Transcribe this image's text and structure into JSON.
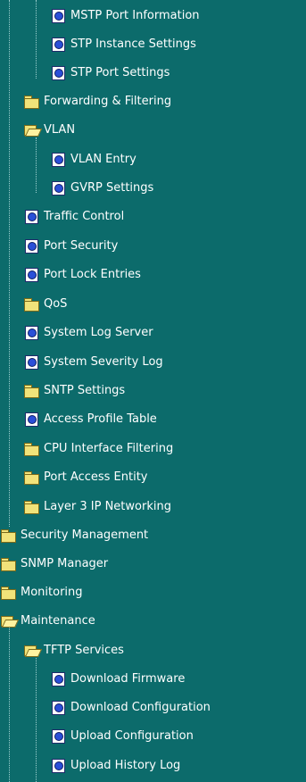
{
  "tree": {
    "items": [
      {
        "label": "MSTP Port Information",
        "icon": "doc-icon"
      },
      {
        "label": "STP Instance Settings",
        "icon": "doc-icon"
      },
      {
        "label": "STP Port Settings",
        "icon": "doc-icon"
      },
      {
        "label": "Forwarding & Filtering",
        "icon": "folder-closed-icon"
      },
      {
        "label": "VLAN",
        "icon": "folder-open-icon"
      },
      {
        "label": "VLAN Entry",
        "icon": "doc-icon"
      },
      {
        "label": "GVRP Settings",
        "icon": "doc-icon"
      },
      {
        "label": "Traffic Control",
        "icon": "doc-icon"
      },
      {
        "label": "Port Security",
        "icon": "doc-icon"
      },
      {
        "label": "Port Lock Entries",
        "icon": "doc-icon"
      },
      {
        "label": "QoS",
        "icon": "folder-closed-icon"
      },
      {
        "label": "System Log Server",
        "icon": "doc-icon"
      },
      {
        "label": "System Severity Log",
        "icon": "doc-icon"
      },
      {
        "label": "SNTP Settings",
        "icon": "folder-closed-icon"
      },
      {
        "label": "Access Profile Table",
        "icon": "doc-icon"
      },
      {
        "label": "CPU Interface Filtering",
        "icon": "folder-closed-icon"
      },
      {
        "label": "Port Access Entity",
        "icon": "folder-closed-icon"
      },
      {
        "label": "Layer 3 IP Networking",
        "icon": "folder-closed-icon"
      },
      {
        "label": "Security Management",
        "icon": "folder-closed-icon"
      },
      {
        "label": "SNMP Manager",
        "icon": "folder-closed-icon"
      },
      {
        "label": "Monitoring",
        "icon": "folder-closed-icon"
      },
      {
        "label": "Maintenance",
        "icon": "folder-open-icon"
      },
      {
        "label": "TFTP Services",
        "icon": "folder-open-icon"
      },
      {
        "label": "Download Firmware",
        "icon": "doc-icon"
      },
      {
        "label": "Download Configuration",
        "icon": "doc-icon"
      },
      {
        "label": "Upload Configuration",
        "icon": "doc-icon"
      },
      {
        "label": "Upload History Log",
        "icon": "doc-icon"
      }
    ]
  },
  "colors": {
    "background": "#0c6b6b",
    "text": "#ffffff",
    "tree_line": "#9fd0d0"
  }
}
